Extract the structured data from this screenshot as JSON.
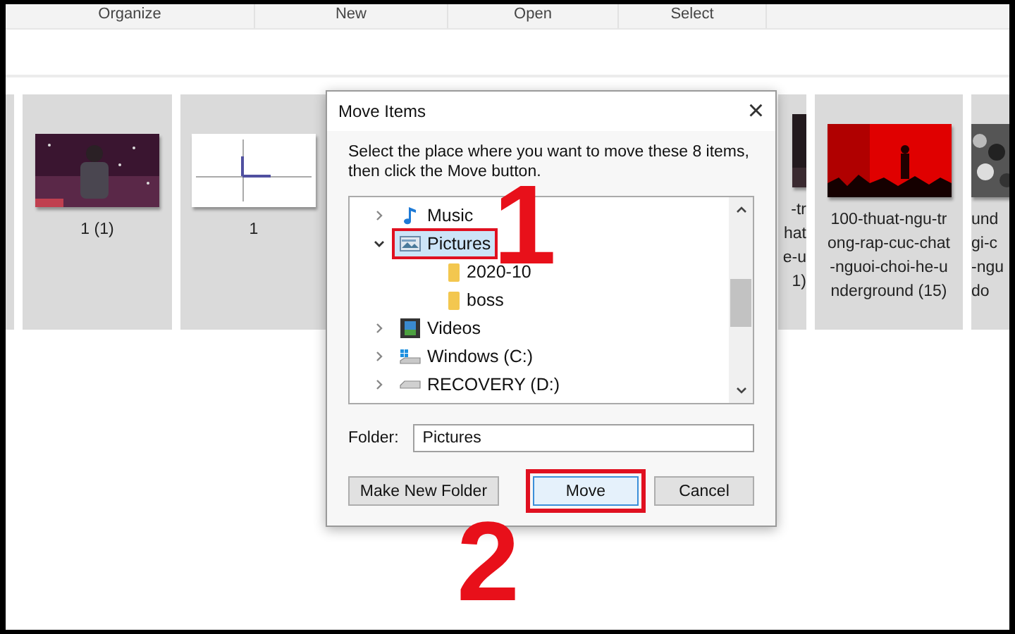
{
  "ribbon": {
    "groups": [
      "Organize",
      "New",
      "Open",
      "Select"
    ]
  },
  "thumbnails": [
    {
      "kind": "sliver"
    },
    {
      "kind": "concert",
      "caption": [
        "1 (1)"
      ]
    },
    {
      "kind": "graph",
      "caption": [
        "1"
      ]
    },
    {
      "kind": "partial",
      "caption": [
        "-tr",
        "hat",
        "e-u",
        "1)"
      ]
    },
    {
      "kind": "red",
      "caption": [
        "100-thuat-ngu-tr",
        "ong-rap-cuc-chat",
        "-nguoi-choi-he-u",
        "nderground (15)"
      ]
    },
    {
      "kind": "crowd",
      "caption": [
        "und",
        "gi-c",
        "-ngu",
        "do"
      ]
    }
  ],
  "dialog": {
    "title": "Move Items",
    "close": "×",
    "instruction": "Select the place where you want to move these 8 items, then click the Move button.",
    "tree": [
      {
        "label": "Music",
        "kind": "music",
        "expanded": false,
        "selected": false,
        "annotated": false
      },
      {
        "label": "Pictures",
        "kind": "pictures",
        "expanded": true,
        "selected": true,
        "annotated": true,
        "children": [
          {
            "label": "2020-10",
            "kind": "folder",
            "selected": false
          },
          {
            "label": "boss",
            "kind": "folder",
            "selected": false
          }
        ]
      },
      {
        "label": "Videos",
        "kind": "videos",
        "expanded": false,
        "selected": false,
        "annotated": false
      },
      {
        "label": "Windows (C:)",
        "kind": "windrive",
        "expanded": false,
        "selected": false,
        "annotated": false
      },
      {
        "label": "RECOVERY (D:)",
        "kind": "drive",
        "expanded": false,
        "selected": false,
        "annotated": false
      }
    ],
    "folder_label": "Folder:",
    "folder_value": "Pictures",
    "buttons": [
      {
        "label": "Make New Folder",
        "default": false,
        "annotated": false
      },
      {
        "label": "Move",
        "default": true,
        "annotated": true
      },
      {
        "label": "Cancel",
        "default": false,
        "annotated": false
      }
    ]
  },
  "annotations": [
    {
      "label": "1"
    },
    {
      "label": "2"
    }
  ]
}
